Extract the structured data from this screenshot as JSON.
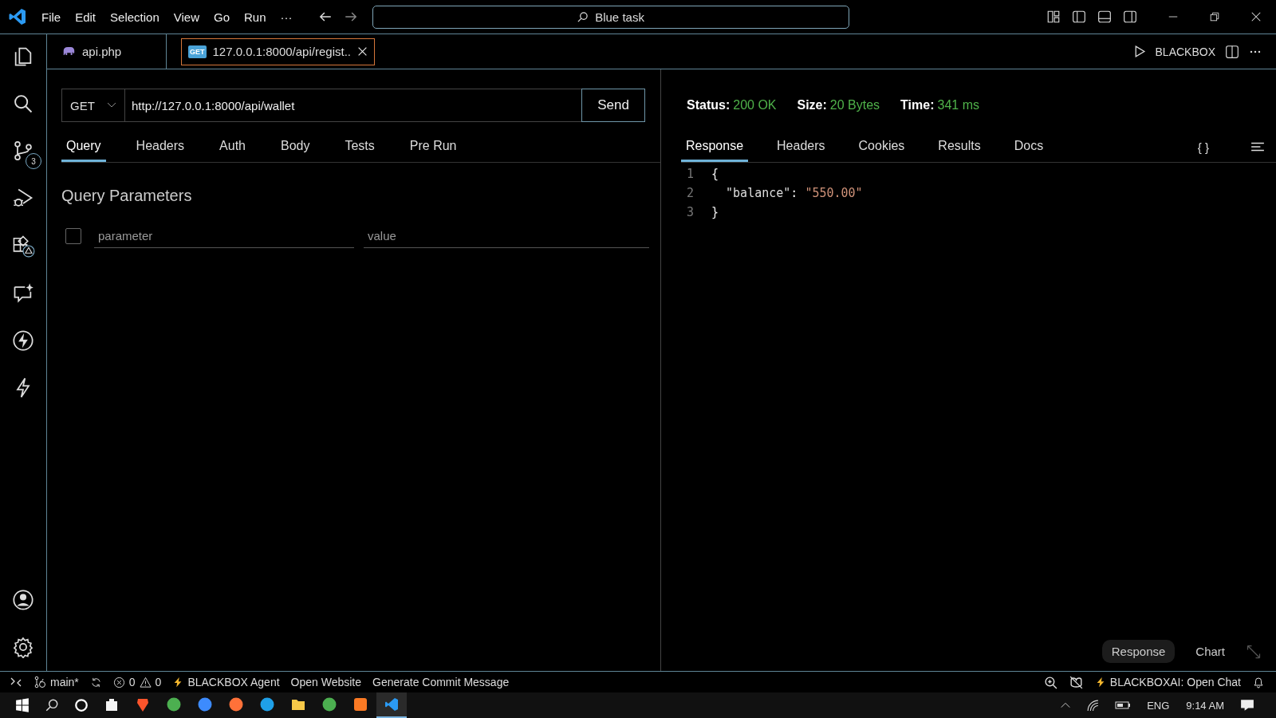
{
  "menu": [
    "File",
    "Edit",
    "Selection",
    "View",
    "Go",
    "Run",
    "···"
  ],
  "command_center": {
    "value": "Blue task"
  },
  "editor_tabs": [
    {
      "label": "api.php",
      "kind": "php",
      "selected": false
    },
    {
      "label": "127.0.0.1:8000/api/regist..",
      "kind": "request",
      "badge": "GET",
      "selected": true
    }
  ],
  "editor_actions": {
    "label": "BLACKBOX"
  },
  "activity_bar": {
    "scm_badge": "3"
  },
  "request": {
    "method": "GET",
    "url": "http://127.0.0.1:8000/api/wallet",
    "send": "Send",
    "tabs": [
      {
        "label": "Query",
        "selected": true
      },
      {
        "label": "Headers",
        "selected": false
      },
      {
        "label": "Auth",
        "selected": false
      },
      {
        "label": "Body",
        "selected": false
      },
      {
        "label": "Tests",
        "selected": false
      },
      {
        "label": "Pre Run",
        "selected": false
      }
    ],
    "section_title": "Query Parameters",
    "param_row": {
      "checked": false,
      "name_placeholder": "parameter",
      "value_placeholder": "value"
    }
  },
  "response": {
    "stats": [
      {
        "label": "Status:",
        "value": "200 OK"
      },
      {
        "label": "Size:",
        "value": "20 Bytes"
      },
      {
        "label": "Time:",
        "value": "341 ms"
      }
    ],
    "tabs": [
      {
        "label": "Response",
        "selected": true
      },
      {
        "label": "Headers",
        "selected": false
      },
      {
        "label": "Cookies",
        "selected": false
      },
      {
        "label": "Results",
        "selected": false
      },
      {
        "label": "Docs",
        "selected": false
      }
    ],
    "format_button": "{ }",
    "lines": [
      {
        "number": "1",
        "tokens": [
          {
            "kind": "punct",
            "text": "{"
          }
        ]
      },
      {
        "number": "2",
        "tokens": [
          {
            "kind": "key",
            "text": "  \"balance\""
          },
          {
            "kind": "punct",
            "text": ": "
          },
          {
            "kind": "string",
            "text": "\"550.00\""
          }
        ]
      },
      {
        "number": "3",
        "tokens": [
          {
            "kind": "punct",
            "text": "}"
          }
        ]
      }
    ],
    "view_toggle": [
      {
        "label": "Response",
        "selected": true
      },
      {
        "label": "Chart",
        "selected": false
      }
    ]
  },
  "status_bar": {
    "branch": "main*",
    "errors": "0",
    "warnings": "0",
    "items": [
      {
        "kind": "bolt",
        "label": "BLACKBOX Agent"
      },
      {
        "kind": "plain",
        "label": "Open Website"
      },
      {
        "kind": "plain",
        "label": "Generate Commit Message"
      }
    ],
    "chat": "BLACKBOXAI: Open Chat"
  },
  "taskbar": {
    "apps": [
      {
        "kind": "store",
        "selected": false
      },
      {
        "kind": "brave",
        "selected": false
      },
      {
        "kind": "chrome",
        "selected": false
      },
      {
        "kind": "appstore",
        "selected": false
      },
      {
        "kind": "firefox",
        "selected": false
      },
      {
        "kind": "edge",
        "selected": false
      },
      {
        "kind": "folder",
        "selected": false
      },
      {
        "kind": "chrome",
        "selected": false
      },
      {
        "kind": "xampp",
        "selected": false
      },
      {
        "kind": "vscode",
        "selected": true
      }
    ],
    "language": "ENG",
    "time": "9:14 AM"
  }
}
